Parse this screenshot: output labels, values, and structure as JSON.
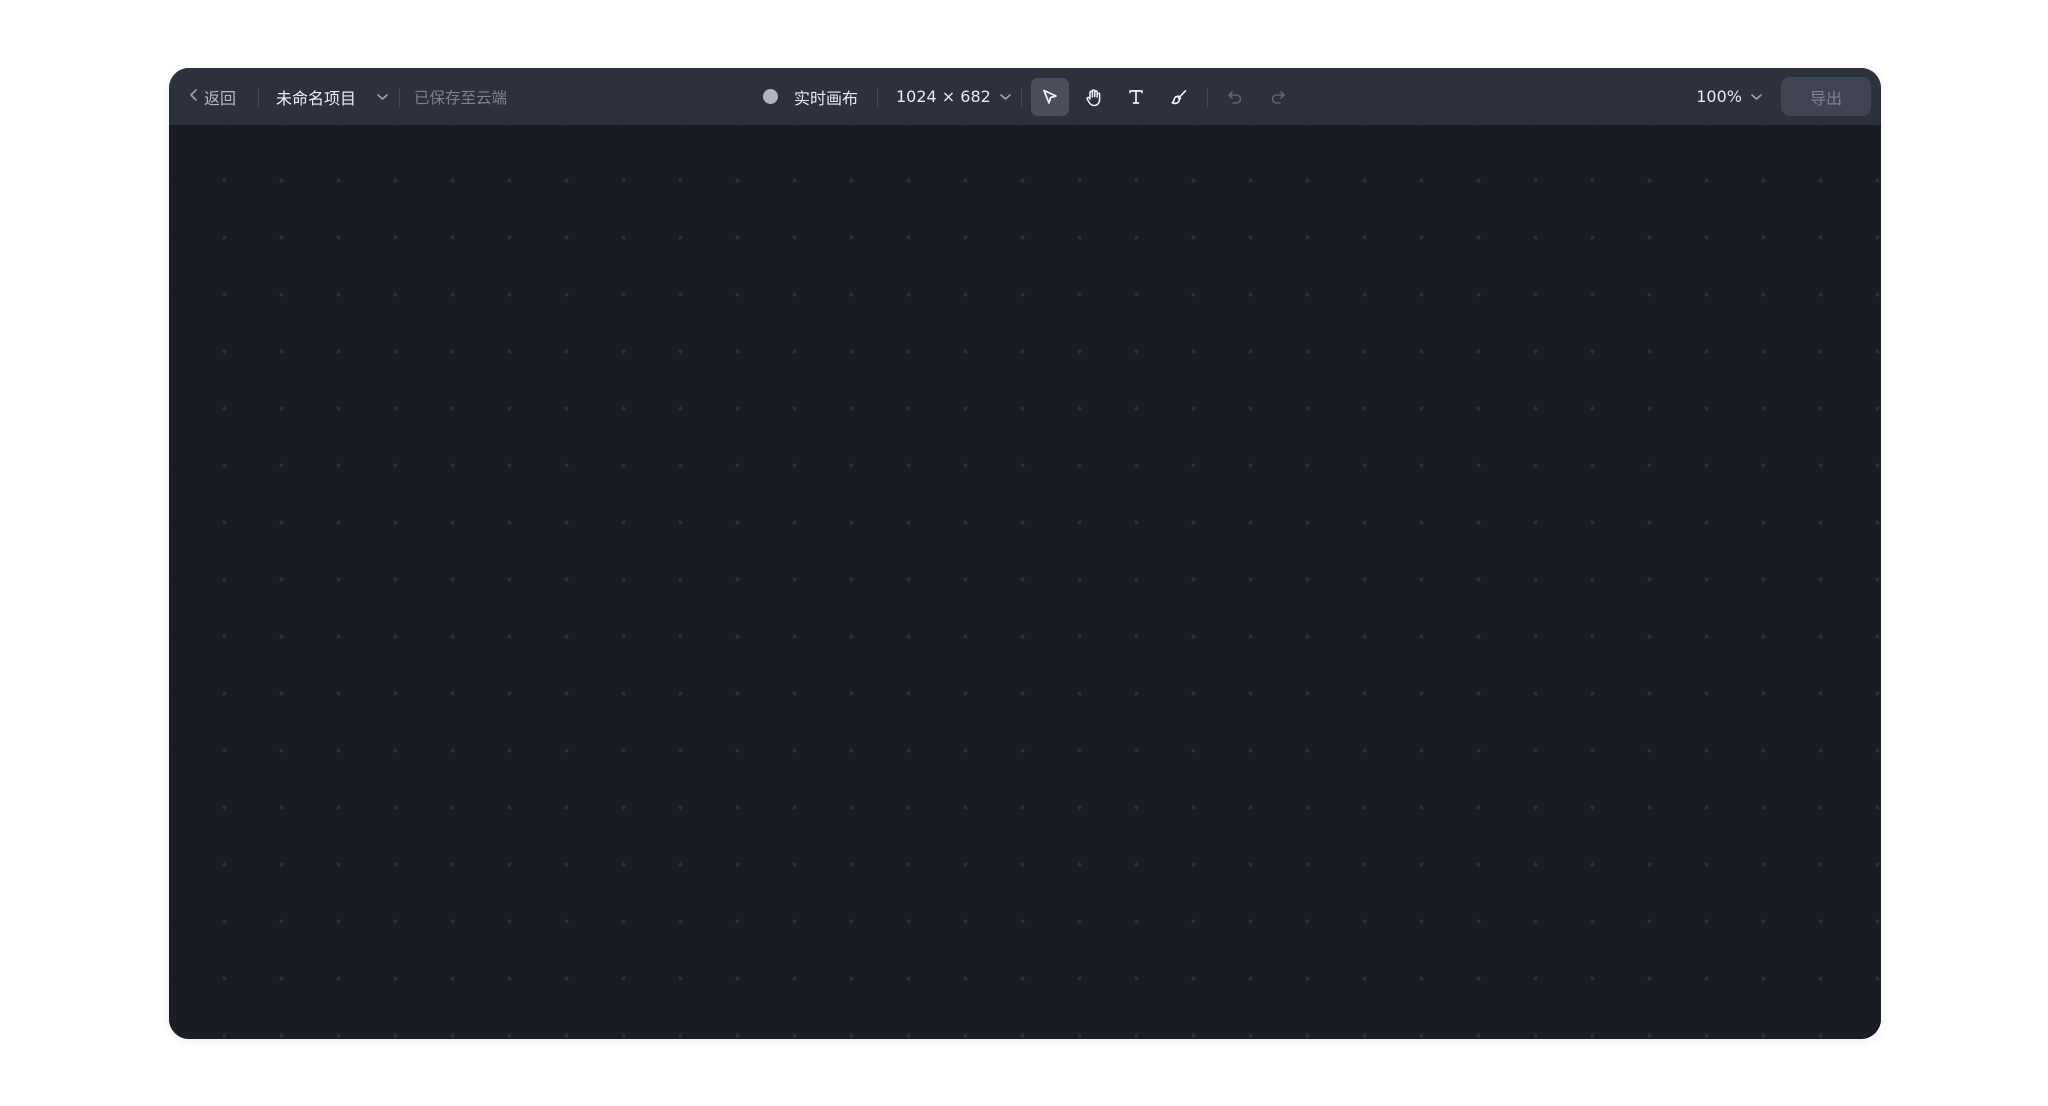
{
  "toolbar": {
    "back_label": "返回",
    "project_name": "未命名项目",
    "save_status": "已保存至云端",
    "canvas_mode": "实时画布",
    "canvas_size": "1024 × 682",
    "zoom": "100%",
    "export_label": "导出",
    "tools": [
      {
        "name": "select",
        "icon": "cursor-arrow-icon",
        "active": true
      },
      {
        "name": "hand",
        "icon": "hand-icon",
        "active": false
      },
      {
        "name": "text",
        "icon": "text-icon",
        "active": false
      },
      {
        "name": "brush",
        "icon": "brush-icon",
        "active": false
      }
    ],
    "history": [
      {
        "name": "undo",
        "icon": "undo-icon",
        "enabled": false
      },
      {
        "name": "redo",
        "icon": "redo-icon",
        "enabled": false
      }
    ]
  },
  "colors": {
    "toolbar_bg": "#2d313d",
    "canvas_bg": "#1b1d26",
    "active_tool_bg": "#4a4f5d",
    "export_bg": "#3f4452",
    "status_dot": "#b1b5bf"
  }
}
